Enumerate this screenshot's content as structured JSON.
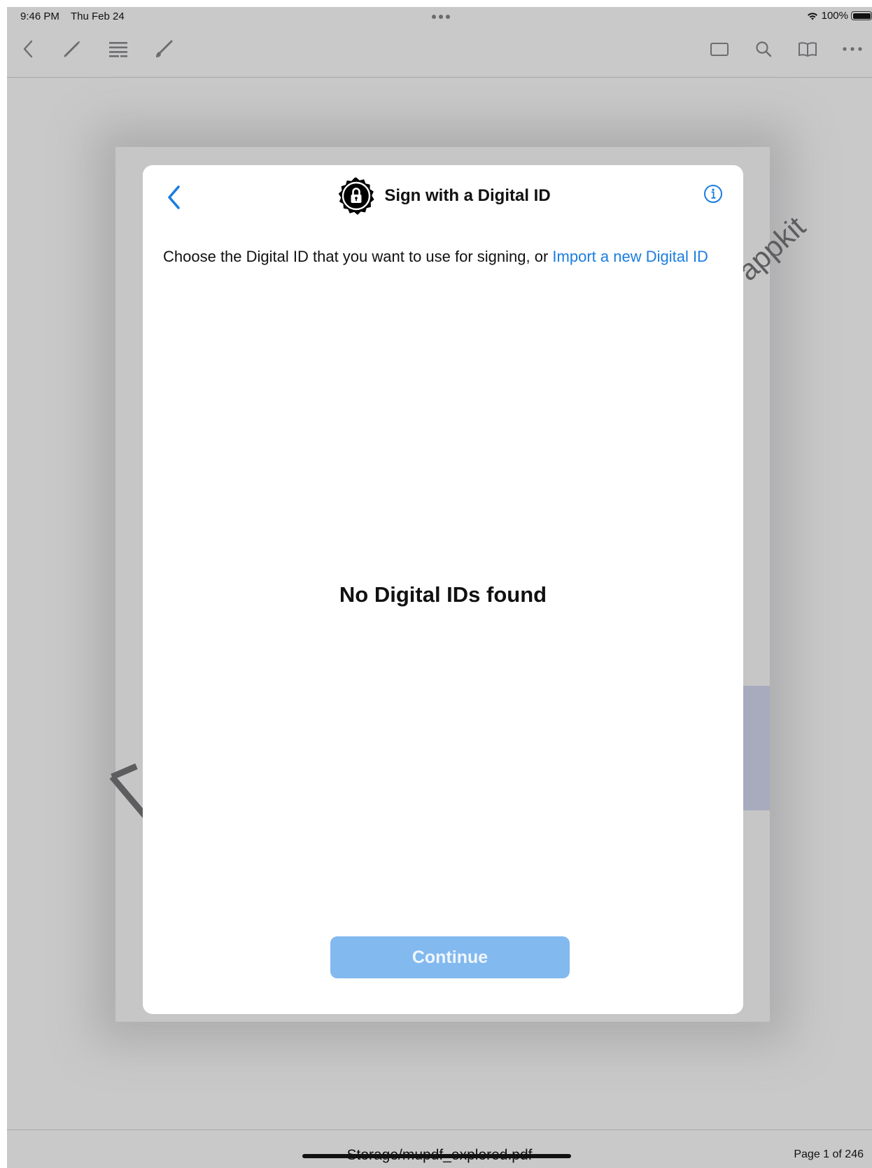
{
  "status_bar": {
    "time": "9:46 PM",
    "date": "Thu Feb 24",
    "battery": "100%"
  },
  "toolbar": {
    "left_icons": [
      "back-chevron-icon",
      "pencil-icon",
      "outline-list-icon",
      "brush-icon"
    ],
    "right_icons": [
      "thumbnail-view-icon",
      "search-icon",
      "book-icon",
      "more-icon"
    ]
  },
  "document": {
    "background_fragment": "appkit"
  },
  "dialog": {
    "title": "Sign with a Digital ID",
    "description_prefix": "Choose the Digital ID that you want to use for signing, or ",
    "import_link": "Import a new Digital ID",
    "empty_state": "No Digital IDs found",
    "continue_label": "Continue",
    "continue_enabled": false,
    "accent_color": "#1a7de0",
    "disabled_button_color": "#82b9ef"
  },
  "footer": {
    "file_path": "Storage/mupdf_explored.pdf",
    "page_indicator": "Page 1 of 246"
  }
}
